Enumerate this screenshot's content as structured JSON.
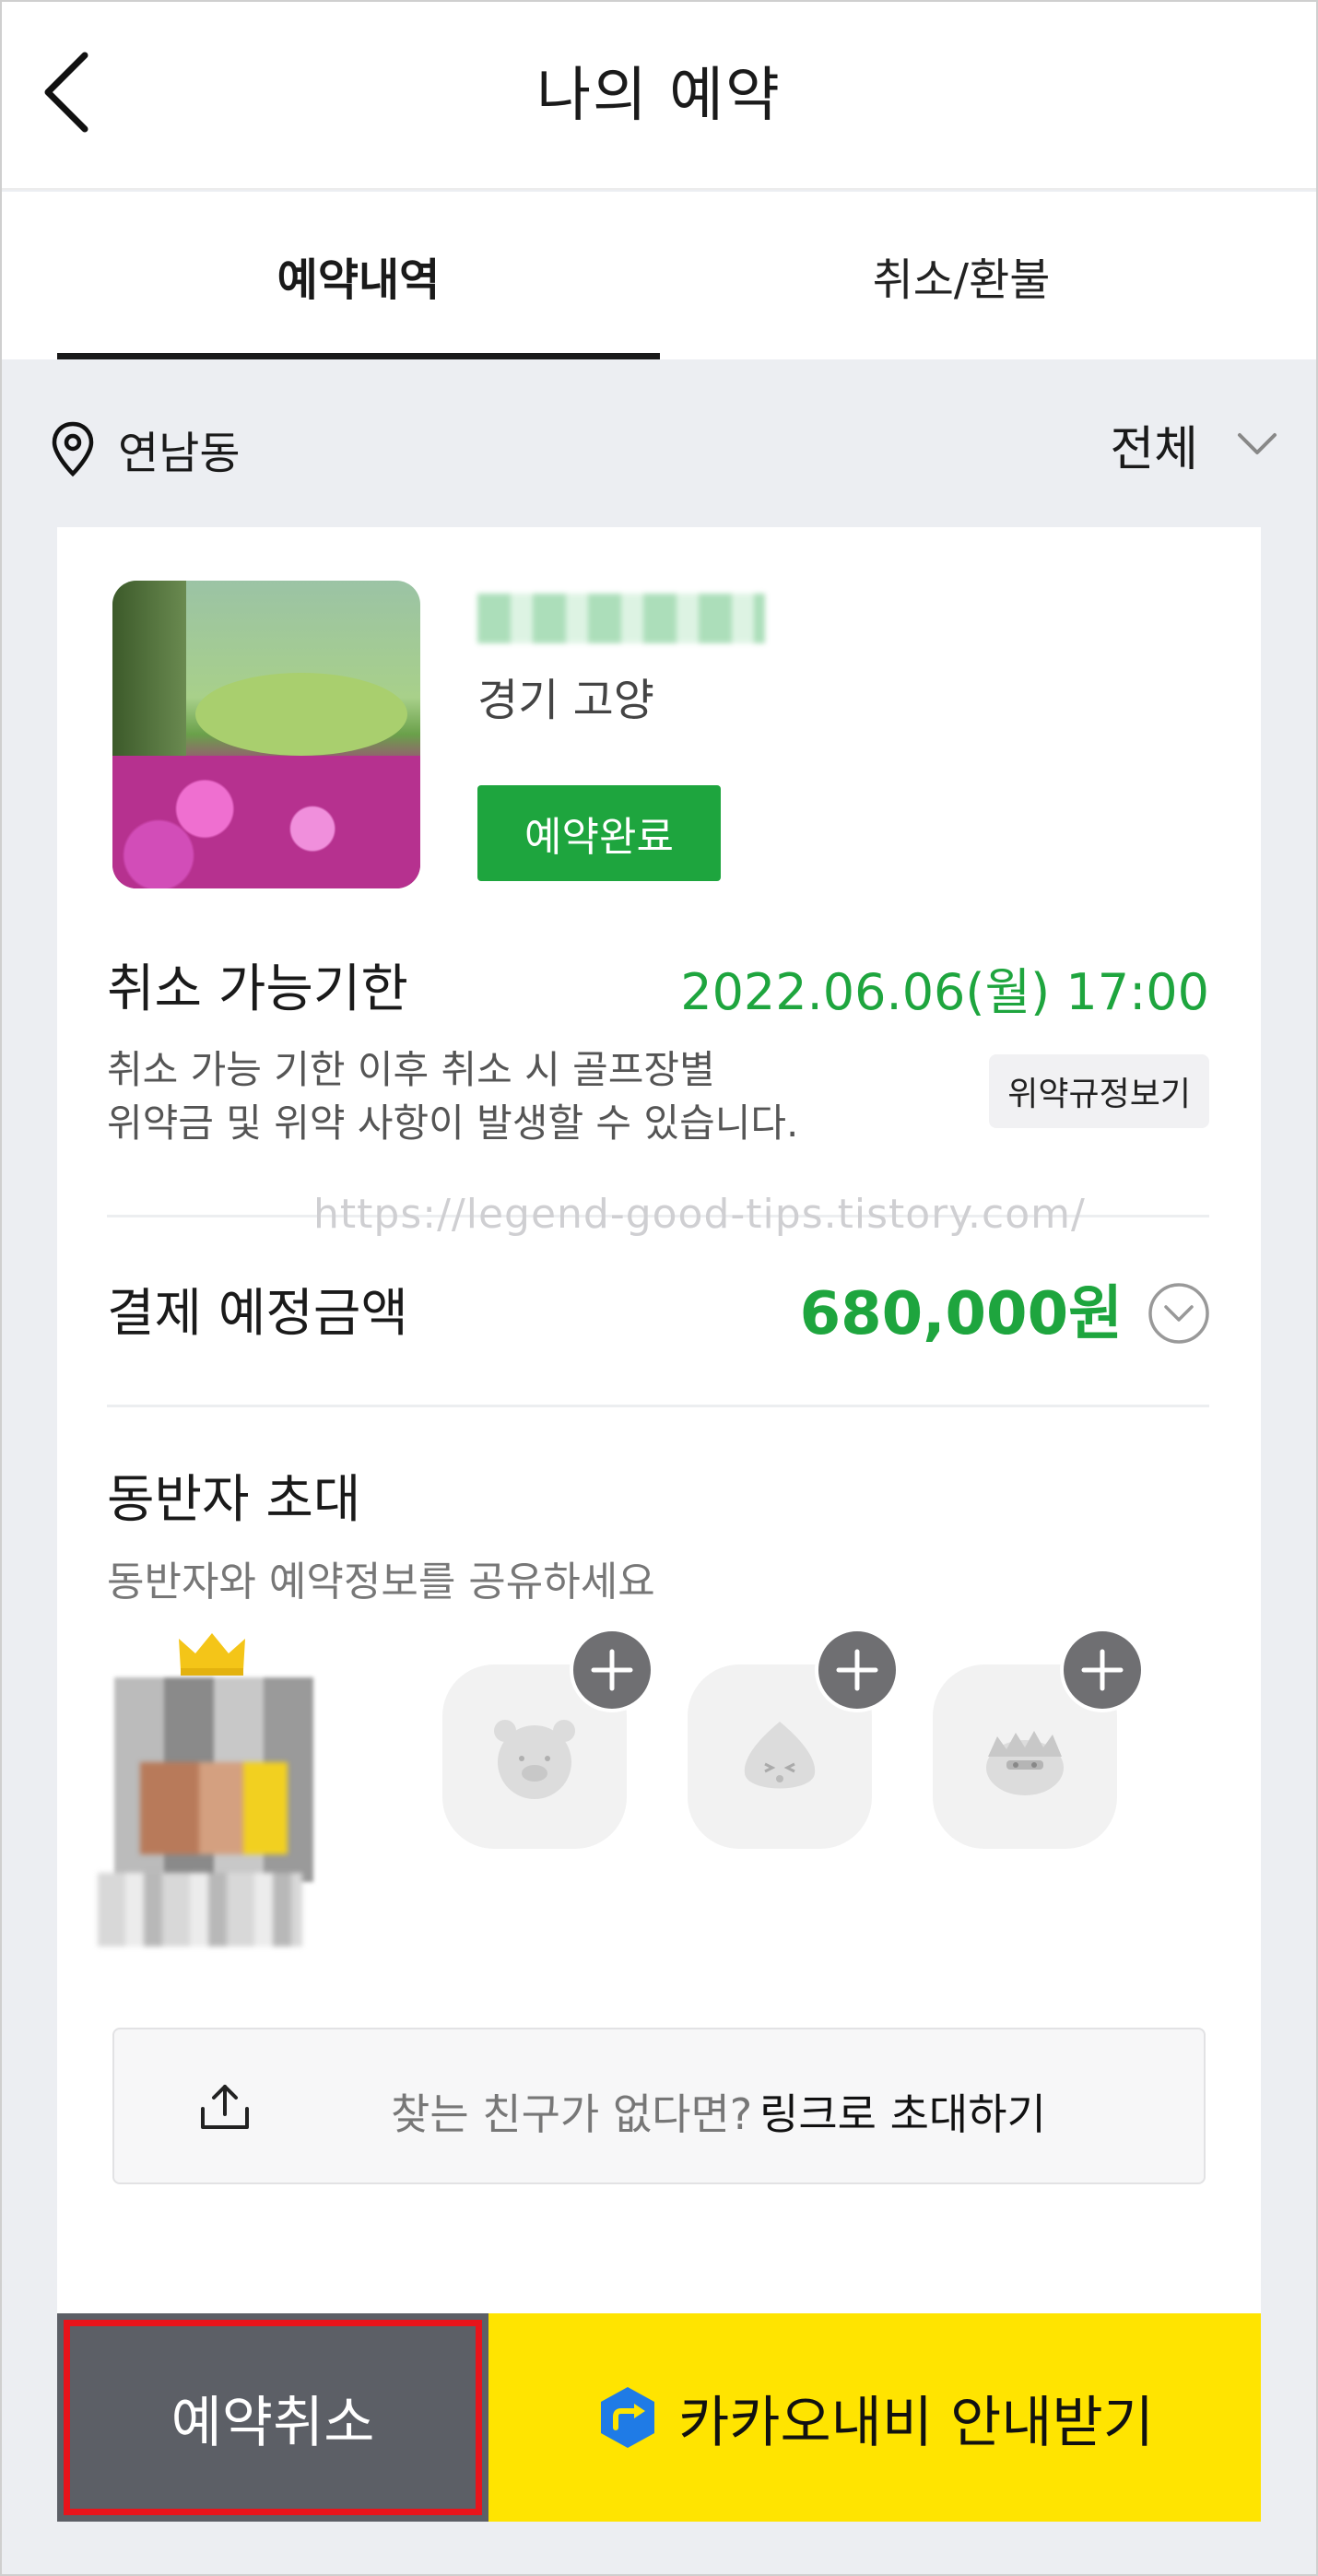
{
  "header": {
    "title": "나의 예약"
  },
  "tabs": [
    {
      "label": "예약내역",
      "active": true
    },
    {
      "label": "취소/환불",
      "active": false
    }
  ],
  "location": {
    "name": "연남동",
    "filter": "전체"
  },
  "reservation": {
    "region": "경기 고양",
    "status": "예약완료",
    "deadline_label": "취소 가능기한",
    "deadline_value": "2022.06.06(월) 17:00",
    "cancel_note_line1": "취소 가능 기한 이후 취소 시 골프장별",
    "cancel_note_line2": "위약금 및 위약 사항이 발생할 수 있습니다.",
    "policy_button": "위약규정보기",
    "payment_label": "결제 예정금액",
    "payment_amount": "680,000원"
  },
  "watermark": "https://legend-good-tips.tistory.com/",
  "companions": {
    "title": "동반자 초대",
    "subtitle": "동반자와 예약정보를 공유하세요",
    "invite_question": "찾는 친구가 없다면?",
    "invite_link": "링크로 초대하기"
  },
  "bottom": {
    "cancel_button": "예약취소",
    "navi_button": "카카오내비 안내받기"
  },
  "colors": {
    "accent_green": "#1ea53e",
    "navi_yellow": "#ffe400",
    "cancel_gray": "#5c5f66",
    "highlight_red": "#e8141b"
  },
  "icons": [
    "back-chevron-icon",
    "location-pin-icon",
    "chevron-down-icon",
    "share-upload-icon",
    "plus-icon",
    "crown-icon",
    "kakao-navi-icon"
  ]
}
